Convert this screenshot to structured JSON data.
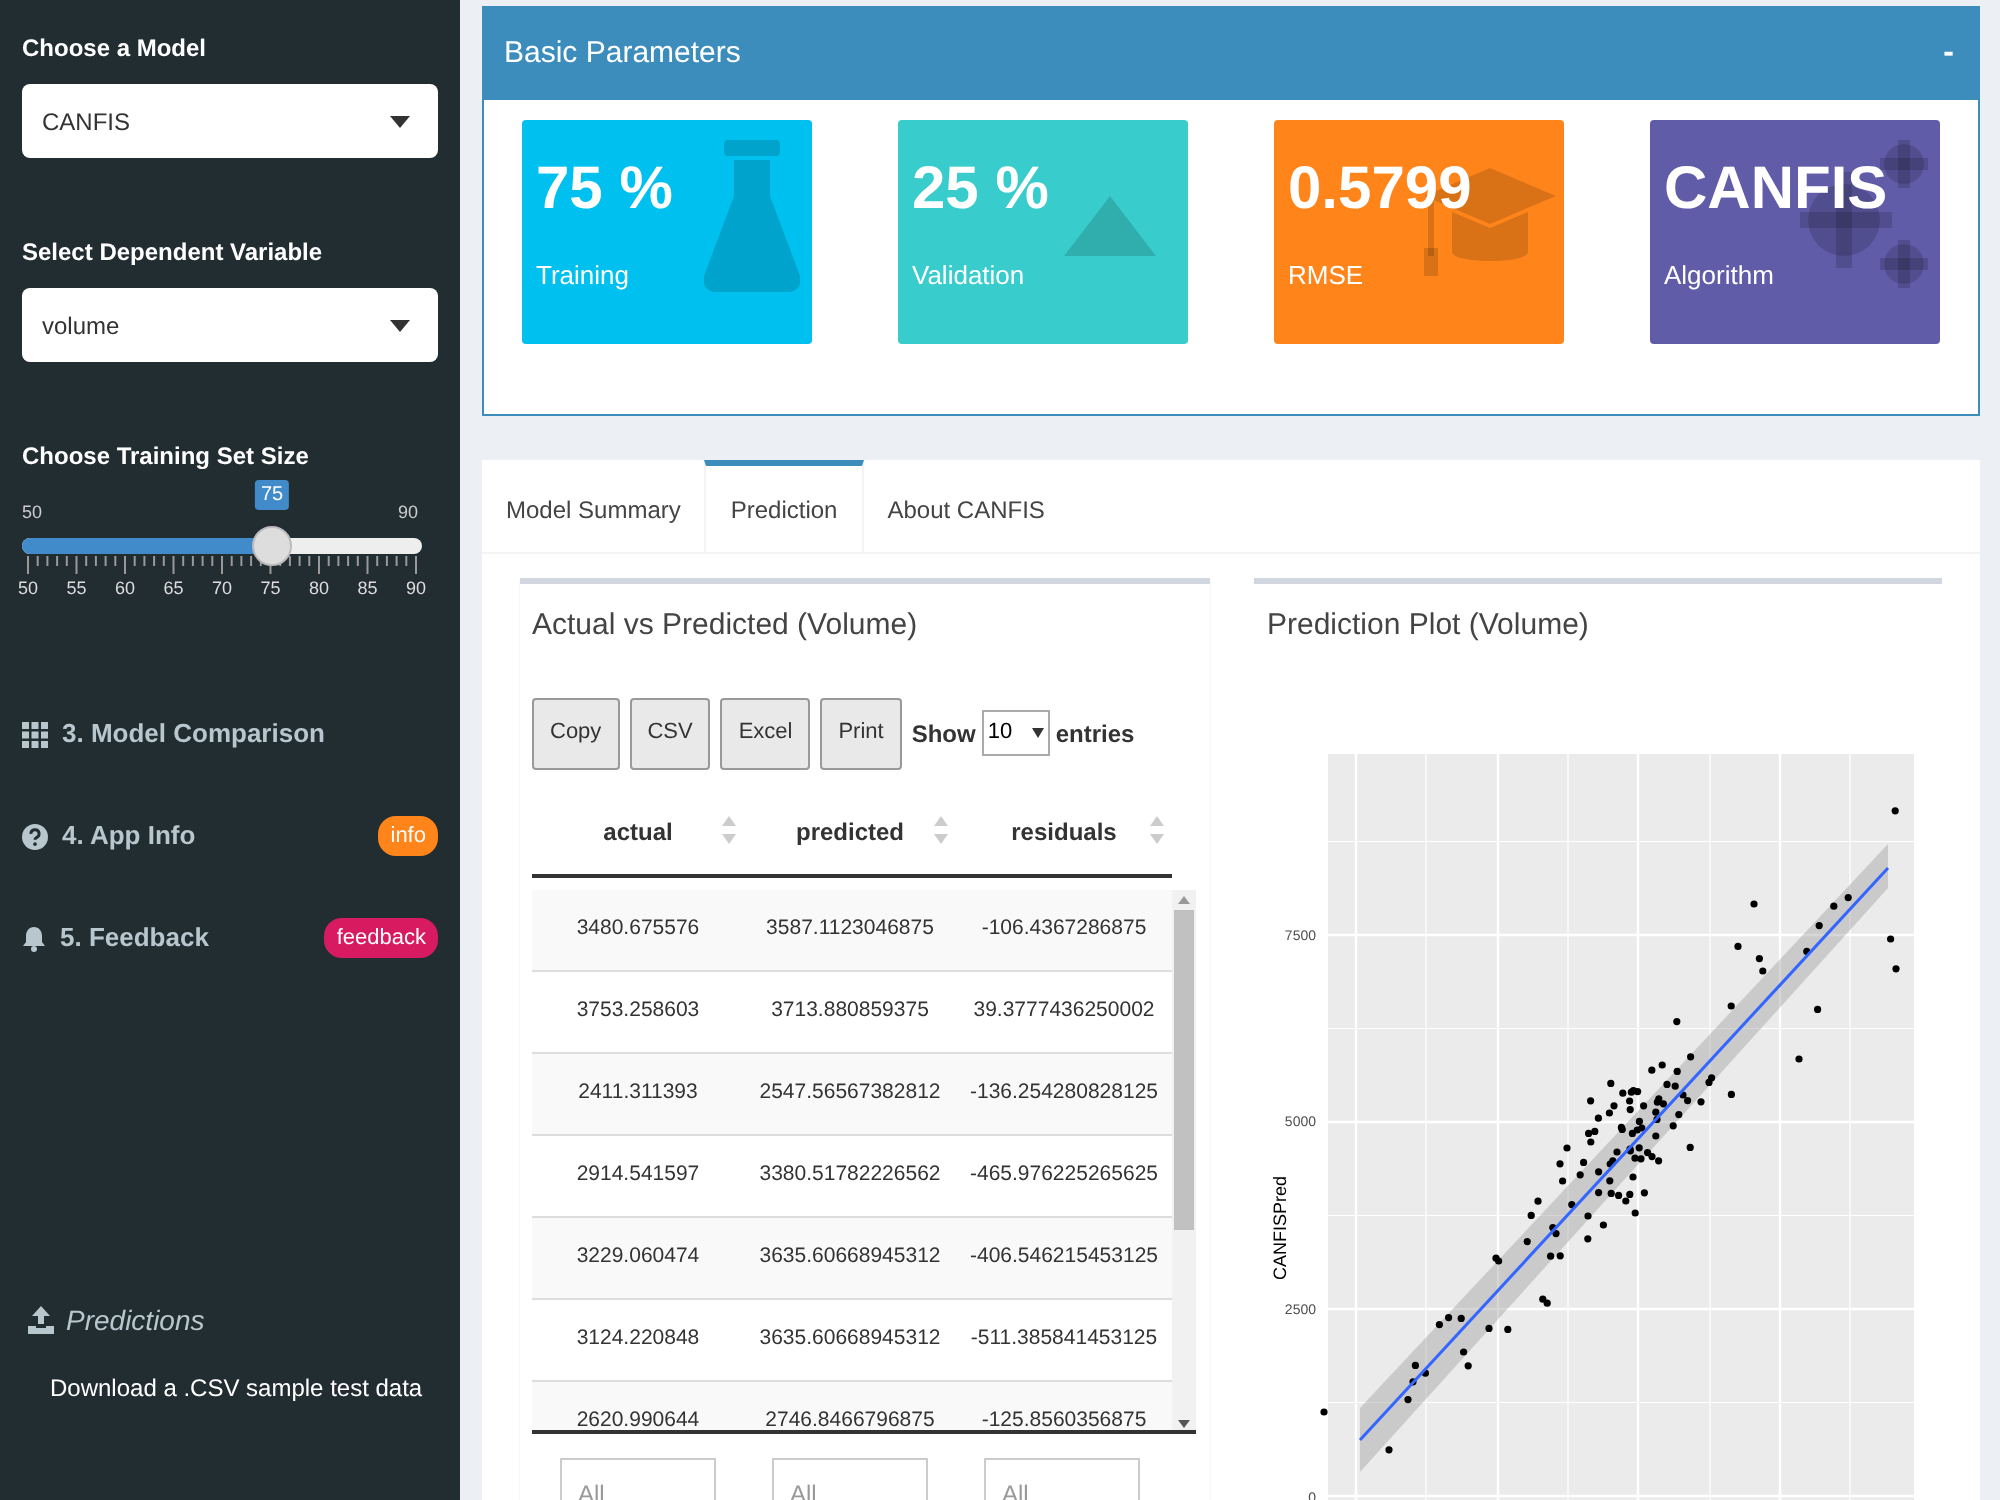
{
  "sidebar": {
    "inputs": [
      {
        "kind": "select",
        "label": "Choose a Model",
        "value": "CANFIS"
      },
      {
        "kind": "select",
        "label": "Select Dependent Variable",
        "value": "volume"
      },
      {
        "kind": "slider",
        "label": "Choose Training Set Size",
        "min": "50",
        "max": "90",
        "value": "75",
        "level": 0.625,
        "ticks": [
          "50",
          "55",
          "60",
          "65",
          "70",
          "75",
          "80",
          "85",
          "90"
        ]
      }
    ],
    "menu": [
      {
        "label": "3. Model Comparison"
      },
      {
        "label": "4. App Info",
        "badge": "info",
        "color": "#ff851b"
      },
      {
        "label": "5. Feedback",
        "badge": "feedback",
        "color": "#d81b60"
      }
    ],
    "upload": {
      "title": "Predictions",
      "link": "Download a .CSV sample test data"
    }
  },
  "parameters_box": {
    "title": "Basic Parameters",
    "collapse": "-",
    "value_boxes": [
      {
        "value": "75 %",
        "label": "Training",
        "color": "#00c0ef"
      },
      {
        "value": "25 %",
        "label": "Validation",
        "color": "#39cccc"
      },
      {
        "value": "0.5799",
        "label": "RMSE",
        "color": "#ff851b"
      },
      {
        "value": "CANFIS",
        "label": "Algorithm",
        "color": "#605ca8"
      }
    ]
  },
  "tabs": [
    {
      "label": "Model Summary",
      "selected": false
    },
    {
      "label": "Prediction",
      "selected": true
    },
    {
      "label": "About CANFIS",
      "selected": false
    }
  ],
  "table_panel": {
    "title": "Actual vs Predicted (Volume)",
    "buttons": [
      "Copy",
      "CSV",
      "Excel",
      "Print"
    ],
    "length_menu": {
      "before": "Show",
      "value": "10",
      "after": "entries"
    },
    "columns": [
      "actual",
      "predicted",
      "residuals"
    ],
    "rows": [
      [
        "3480.675576",
        "3587.1123046875",
        "-106.4367286875"
      ],
      [
        "3753.258603",
        "3713.880859375",
        "39.3777436250002"
      ],
      [
        "2411.311393",
        "2547.56567382812",
        "-136.254280828125"
      ],
      [
        "2914.541597",
        "3380.51782226562",
        "-465.976225265625"
      ],
      [
        "3229.060474",
        "3635.60668945312",
        "-406.546215453125"
      ],
      [
        "3124.220848",
        "3635.60668945312",
        "-511.385841453125"
      ],
      [
        "2620.990644",
        "2746.8466796875",
        "-125.8560356875"
      ]
    ],
    "filters": [
      {
        "placeholder": "All"
      },
      {
        "placeholder": "All"
      },
      {
        "placeholder": "All"
      }
    ]
  },
  "plot_panel": {
    "title": "Prediction Plot (Volume)",
    "ylabel": "CANFISPred",
    "yticks": [
      "7500",
      "5000",
      "2500",
      "0"
    ]
  }
}
